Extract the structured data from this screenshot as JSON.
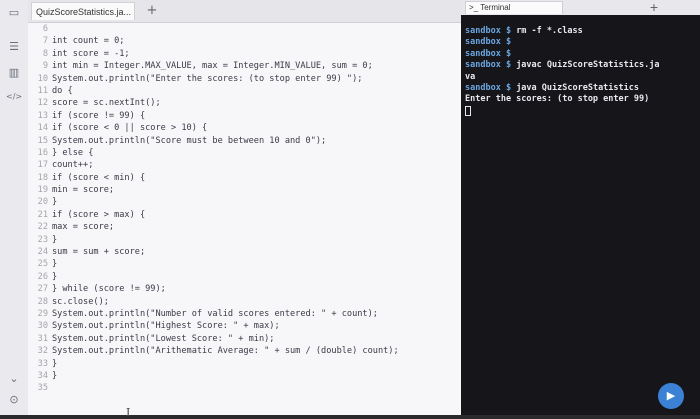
{
  "sidebar": {
    "icons": [
      {
        "name": "files-icon",
        "glyph": "▭"
      },
      {
        "name": "list-icon",
        "glyph": "☰"
      },
      {
        "name": "chart-icon",
        "glyph": "▥"
      },
      {
        "name": "code-icon",
        "glyph": "</>"
      }
    ],
    "bottom_icons": [
      {
        "name": "chevron-down-icon",
        "glyph": "⌄"
      },
      {
        "name": "settings-icon",
        "glyph": "⊙"
      }
    ]
  },
  "editor": {
    "tab_label": "QuizScoreStatistics.ja...",
    "add_tab": "+",
    "lines": [
      {
        "n": "6",
        "text": ""
      },
      {
        "n": "7",
        "text": "int count = 0;"
      },
      {
        "n": "8",
        "text": "int score = -1;"
      },
      {
        "n": "9",
        "text": "int min = Integer.MAX_VALUE, max = Integer.MIN_VALUE, sum = 0;"
      },
      {
        "n": "10",
        "text": "System.out.println(\"Enter the scores: (to stop enter 99) \");"
      },
      {
        "n": "11",
        "text": "do {"
      },
      {
        "n": "12",
        "text": "score = sc.nextInt();"
      },
      {
        "n": "13",
        "text": "if (score != 99) {"
      },
      {
        "n": "14",
        "text": "if (score < 0 || score > 10) {"
      },
      {
        "n": "15",
        "text": "System.out.println(\"Score must be between 10 and 0\");"
      },
      {
        "n": "16",
        "text": "} else {"
      },
      {
        "n": "17",
        "text": "count++;"
      },
      {
        "n": "18",
        "text": "if (score < min) {"
      },
      {
        "n": "19",
        "text": "min = score;"
      },
      {
        "n": "20",
        "text": "}"
      },
      {
        "n": "21",
        "text": "if (score > max) {"
      },
      {
        "n": "22",
        "text": "max = score;"
      },
      {
        "n": "23",
        "text": "}"
      },
      {
        "n": "24",
        "text": "sum = sum + score;"
      },
      {
        "n": "25",
        "text": "}"
      },
      {
        "n": "26",
        "text": "}"
      },
      {
        "n": "27",
        "text": "} while (score != 99);"
      },
      {
        "n": "28",
        "text": "sc.close();"
      },
      {
        "n": "29",
        "text": "System.out.println(\"Number of valid scores entered: \" + count);"
      },
      {
        "n": "30",
        "text": "System.out.println(\"Highest Score: \" + max);"
      },
      {
        "n": "31",
        "text": "System.out.println(\"Lowest Score: \" + min);"
      },
      {
        "n": "32",
        "text": "System.out.println(\"Arithematic Average: \" + sum / (double) count);"
      },
      {
        "n": "33",
        "text": "}"
      },
      {
        "n": "34",
        "text": "}"
      },
      {
        "n": "35",
        "text": ""
      }
    ],
    "text_cursor": "I"
  },
  "terminal": {
    "tab_label": "Terminal",
    "tab_icon": ">_",
    "add_tab": "+",
    "lines": [
      {
        "prompt": "sandbox $ ",
        "cmd": "rm -f *.class"
      },
      {
        "prompt": "sandbox $ ",
        "cmd": ""
      },
      {
        "prompt": "sandbox $ ",
        "cmd": ""
      },
      {
        "prompt": "sandbox $ ",
        "cmd": "javac QuizScoreStatistics.ja"
      },
      {
        "prompt": "",
        "cmd": "va"
      },
      {
        "prompt": "sandbox $ ",
        "cmd": "java QuizScoreStatistics"
      },
      {
        "prompt": "",
        "cmd": "Enter the scores: (to stop enter 99)"
      }
    ],
    "play_icon": "▶"
  },
  "colors": {
    "editor_bg": "#f7f7f9",
    "terminal_bg": "#15151a",
    "prompt": "#6aa6e0",
    "accent": "#3b82d6"
  }
}
